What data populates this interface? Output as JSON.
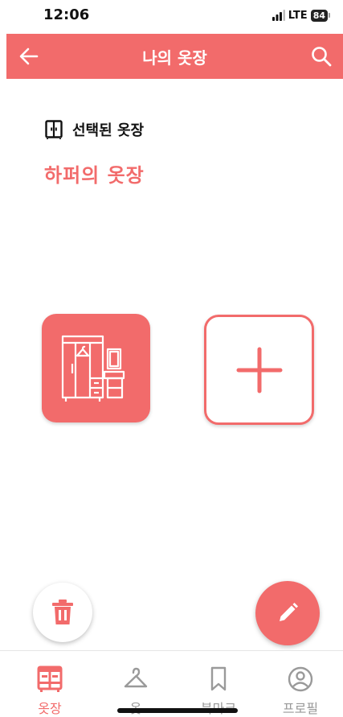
{
  "status_bar": {
    "time": "12:06",
    "network": "LTE",
    "battery": "84"
  },
  "header": {
    "title": "나의 옷장",
    "back_icon": "arrow-left-icon",
    "search_icon": "search-icon"
  },
  "selected": {
    "label": "선택된 옷장",
    "name": "하퍼의 옷장",
    "icon": "wardrobe-icon"
  },
  "cards": {
    "wardrobe_icon": "wardrobe-closet-icon",
    "add_icon": "plus-icon"
  },
  "actions": {
    "delete_icon": "trash-icon",
    "edit_icon": "pencil-icon"
  },
  "bottom_nav": {
    "items": [
      {
        "label": "옷장",
        "icon": "wardrobe-icon",
        "active": true
      },
      {
        "label": "옷",
        "icon": "hanger-icon",
        "active": false
      },
      {
        "label": "북마크",
        "icon": "bookmark-icon",
        "active": false
      },
      {
        "label": "프로필",
        "icon": "profile-icon",
        "active": false
      }
    ]
  },
  "colors": {
    "accent": "#f26b6b",
    "inactive": "#9a9a9a",
    "text": "#111111"
  }
}
